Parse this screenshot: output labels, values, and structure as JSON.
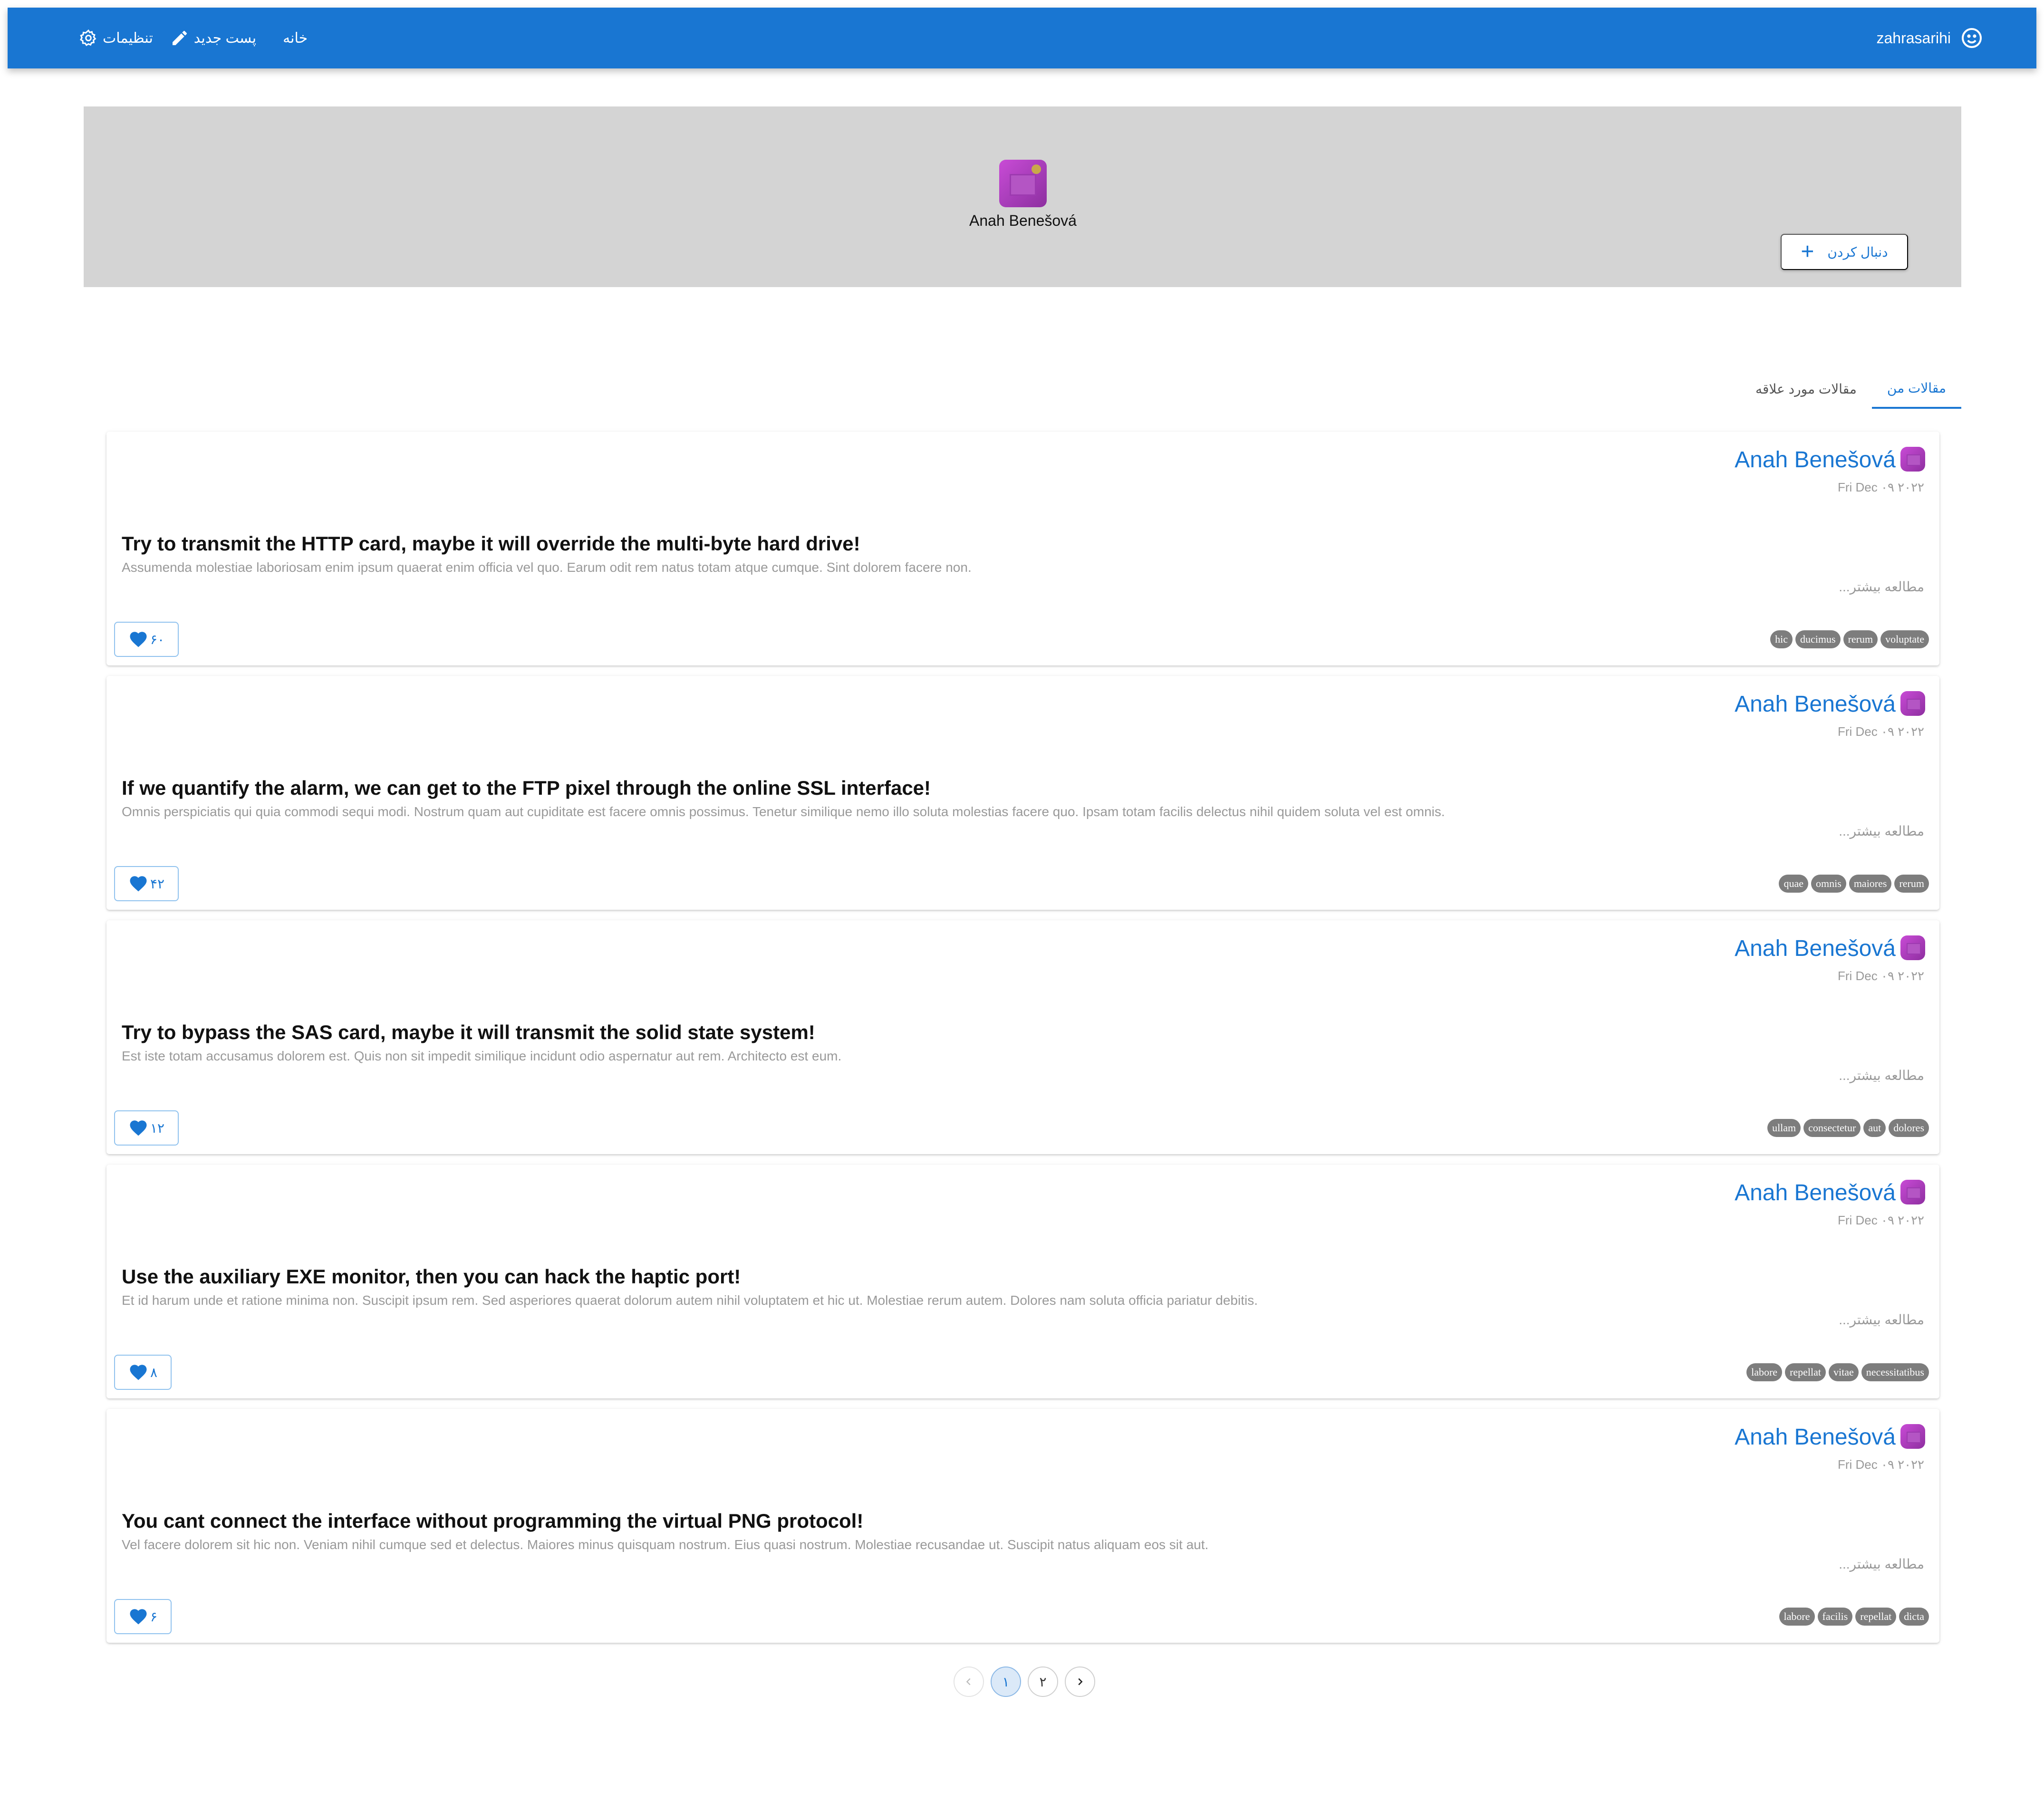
{
  "appbar": {
    "username": "zahrasarihi",
    "user_icon": "smile-icon",
    "nav": {
      "home": "خانه",
      "new_post": "پست جدید",
      "settings": "تنظیمات"
    }
  },
  "profile": {
    "name": "Anah Benešová",
    "follow_label": "دنبال کردن"
  },
  "tabs": [
    {
      "label": "مقالات من",
      "active": true
    },
    {
      "label": "مقالات مورد علاقه",
      "active": false
    }
  ],
  "posts": [
    {
      "author": "Anah Benešová",
      "date": "Fri Dec ۰۹ ۲۰۲۲",
      "title": "Try to transmit the HTTP card, maybe it will override the multi-byte hard drive!",
      "excerpt": "Assumenda molestiae laboriosam enim ipsum quaerat enim officia vel quo. Earum odit rem natus totam atque cumque. Sint dolorem facere non.",
      "read_more": "مطالعه بیشتر...",
      "likes": "۶۰",
      "tags": [
        "hic",
        "ducimus",
        "rerum",
        "voluptate"
      ]
    },
    {
      "author": "Anah Benešová",
      "date": "Fri Dec ۰۹ ۲۰۲۲",
      "title": "If we quantify the alarm, we can get to the FTP pixel through the online SSL interface!",
      "excerpt": "Omnis perspiciatis qui quia commodi sequi modi. Nostrum quam aut cupiditate est facere omnis possimus. Tenetur similique nemo illo soluta molestias facere quo. Ipsam totam facilis delectus nihil quidem soluta vel est omnis.",
      "read_more": "مطالعه بیشتر...",
      "likes": "۴۲",
      "tags": [
        "quae",
        "omnis",
        "maiores",
        "rerum"
      ]
    },
    {
      "author": "Anah Benešová",
      "date": "Fri Dec ۰۹ ۲۰۲۲",
      "title": "Try to bypass the SAS card, maybe it will transmit the solid state system!",
      "excerpt": "Est iste totam accusamus dolorem est. Quis non sit impedit similique incidunt odio aspernatur aut rem. Architecto est eum.",
      "read_more": "مطالعه بیشتر...",
      "likes": "۱۲",
      "tags": [
        "ullam",
        "consectetur",
        "aut",
        "dolores"
      ]
    },
    {
      "author": "Anah Benešová",
      "date": "Fri Dec ۰۹ ۲۰۲۲",
      "title": "Use the auxiliary EXE monitor, then you can hack the haptic port!",
      "excerpt": "Et id harum unde et ratione minima non. Suscipit ipsum rem. Sed asperiores quaerat dolorum autem nihil voluptatem et hic ut. Molestiae rerum autem. Dolores nam soluta officia pariatur debitis.",
      "read_more": "مطالعه بیشتر...",
      "likes": "۸",
      "tags": [
        "labore",
        "repellat",
        "vitae",
        "necessitatibus"
      ]
    },
    {
      "author": "Anah Benešová",
      "date": "Fri Dec ۰۹ ۲۰۲۲",
      "title": "You cant connect the interface without programming the virtual PNG protocol!",
      "excerpt": "Vel facere dolorem sit hic non. Veniam nihil cumque sed et delectus. Maiores minus quisquam nostrum. Eius quasi nostrum. Molestiae recusandae ut. Suscipit natus aliquam eos sit aut.",
      "read_more": "مطالعه بیشتر...",
      "likes": "۶",
      "tags": [
        "labore",
        "facilis",
        "repellat",
        "dicta"
      ]
    }
  ],
  "pagination": {
    "pages": [
      "۱",
      "۲"
    ],
    "current": "۱"
  },
  "colors": {
    "primary": "#1976d2",
    "header_bg": "#d4d4d4",
    "tag_bg": "#7d7d7d"
  }
}
